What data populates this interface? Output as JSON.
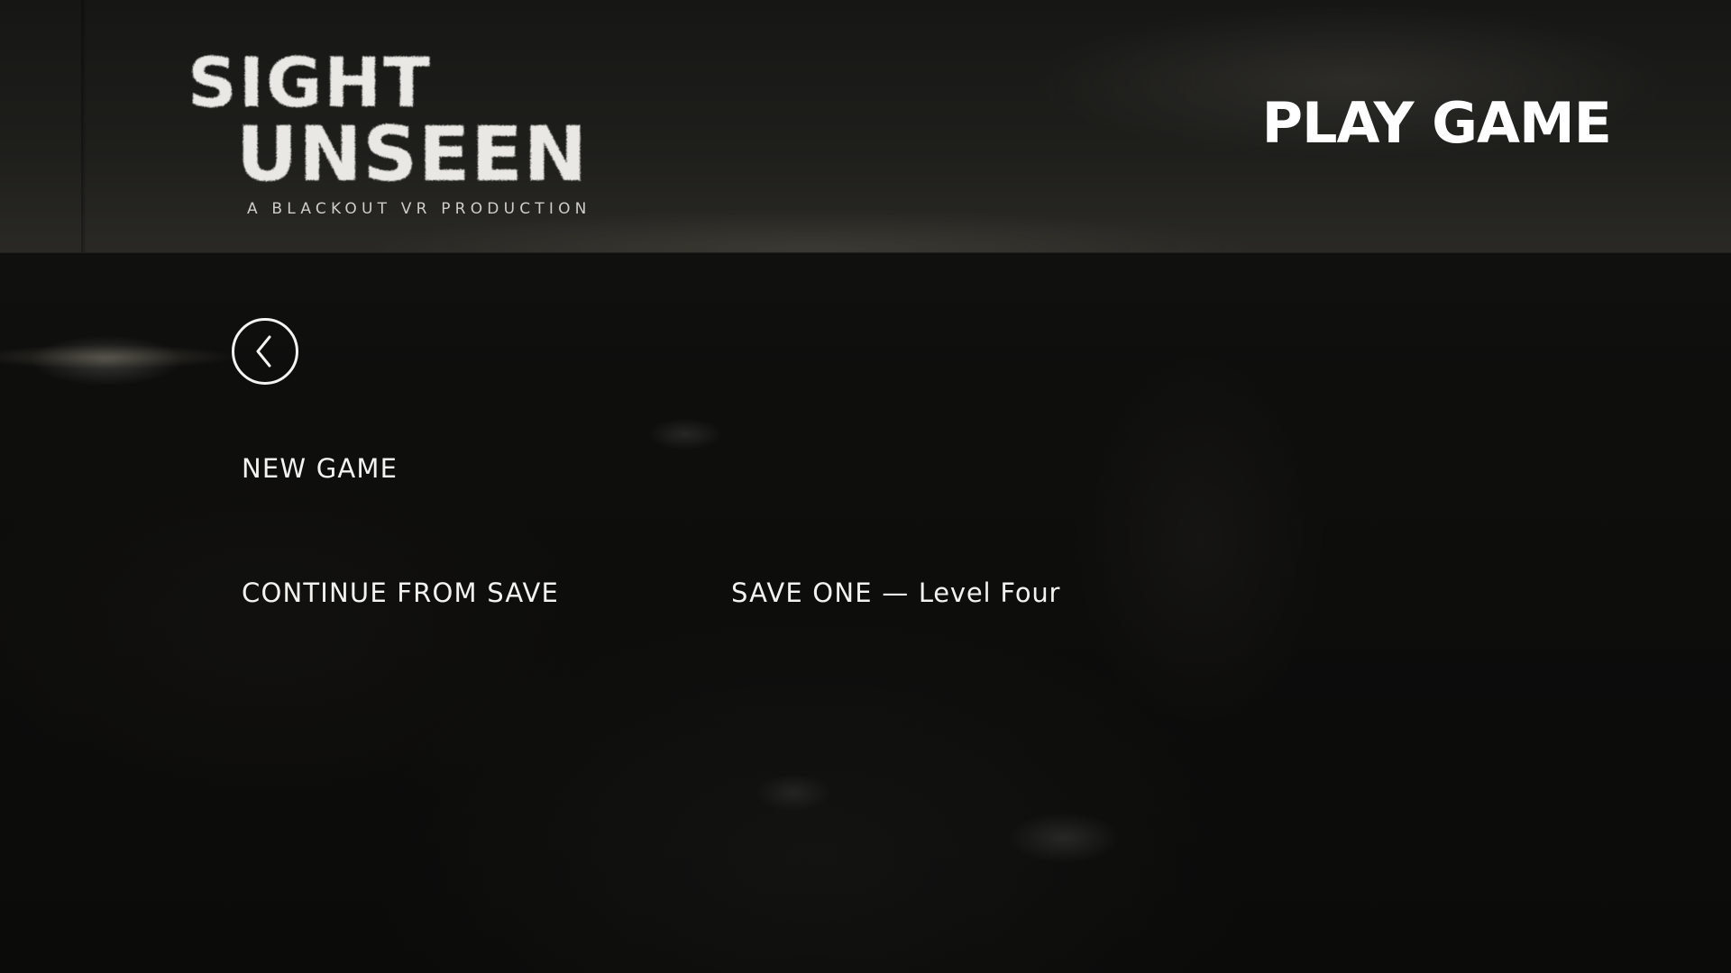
{
  "logo": {
    "line1": "SIGHT",
    "line2": "UNSEEN",
    "tagline": "A BLACKOUT VR PRODUCTION"
  },
  "header": {
    "title": "PLAY GAME"
  },
  "back": {
    "icon": "chevron-left-icon"
  },
  "menu": {
    "new_game": "NEW GAME",
    "continue": "CONTINUE FROM SAVE",
    "save_slot": {
      "name": "SAVE ONE",
      "separator": "—",
      "level": "Level Four"
    }
  },
  "colors": {
    "text": "#f2f2ef",
    "background": "#0d0d0c",
    "header_background": "#1e1e1b"
  }
}
